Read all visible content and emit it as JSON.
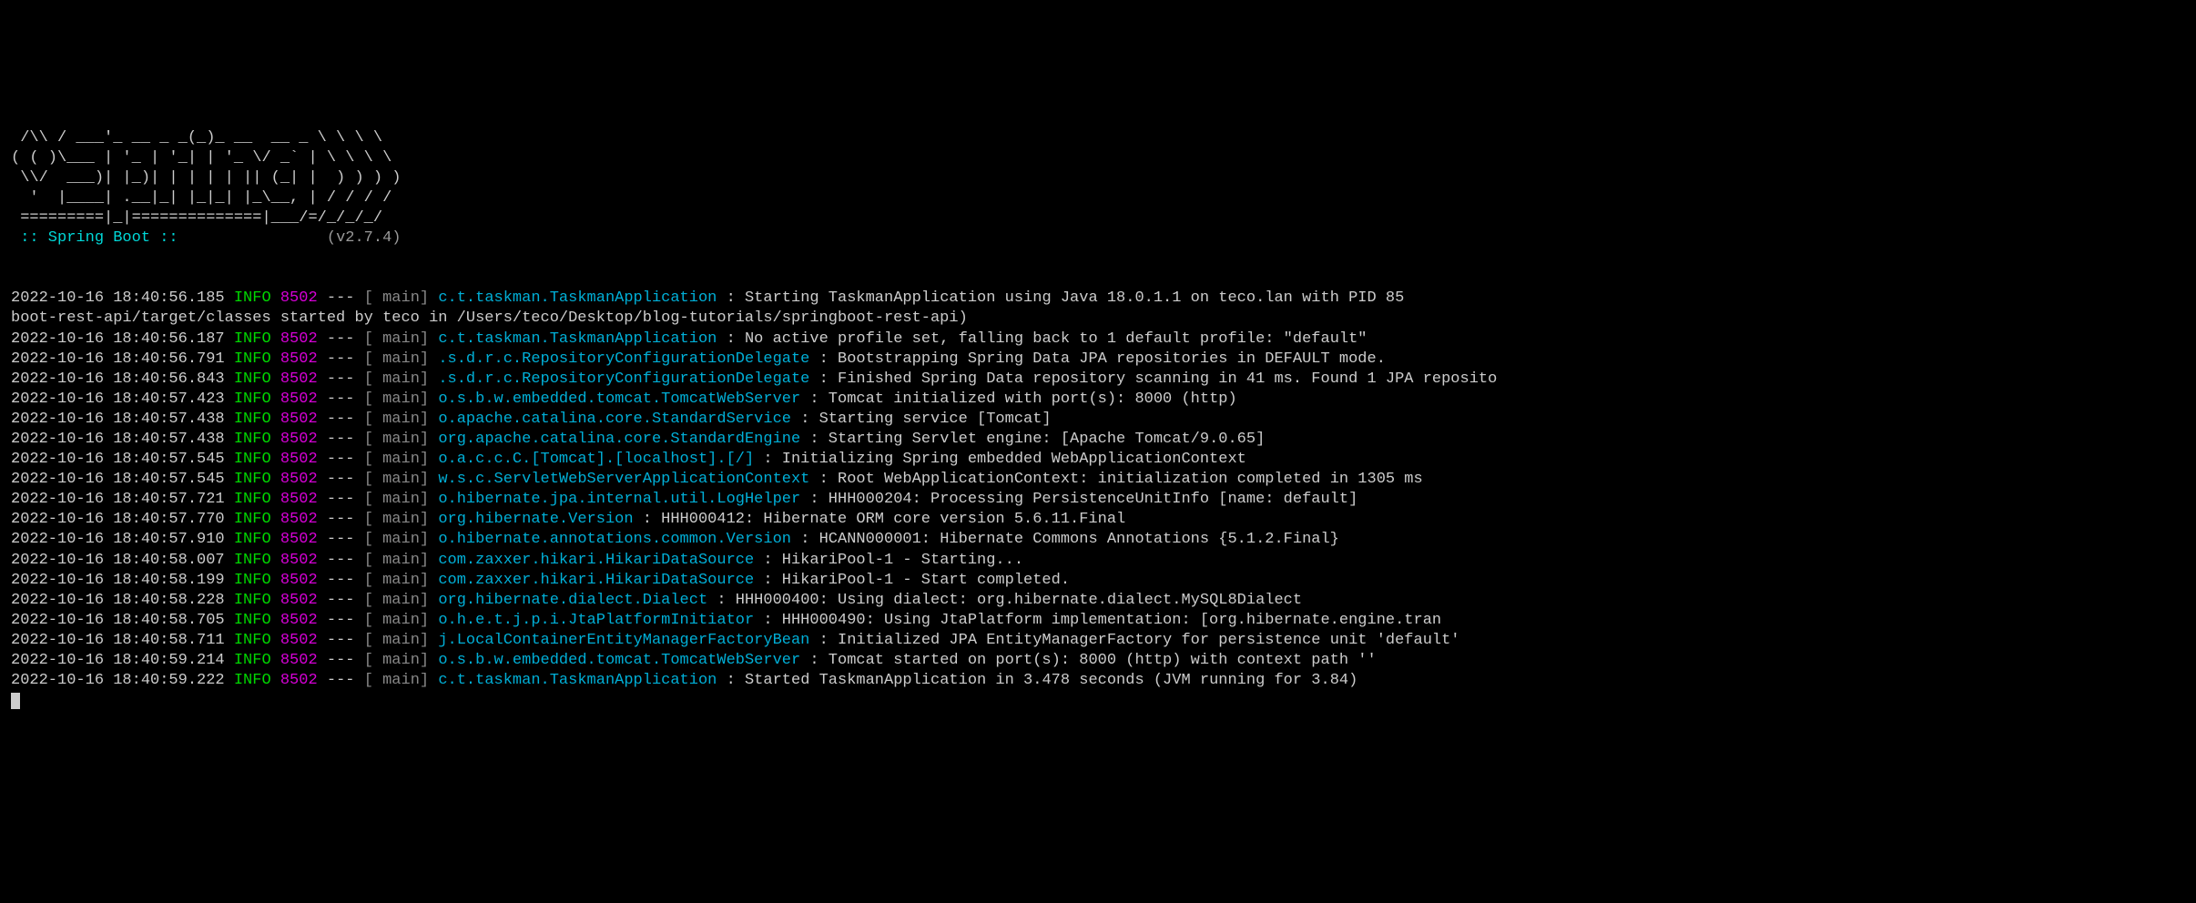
{
  "banner": {
    "lines": [
      " /\\\\ / ___'_ __ _ _(_)_ __  __ _ \\ \\ \\ \\",
      "( ( )\\___ | '_ | '_| | '_ \\/ _` | \\ \\ \\ \\",
      " \\\\/  ___)| |_)| | | | | || (_| |  ) ) ) )",
      "  '  |____| .__|_| |_|_| |_\\__, | / / / /",
      " =========|_|==============|___/=/_/_/_/"
    ],
    "springBootLabel": " :: Spring Boot ::",
    "version": "(v2.7.4)"
  },
  "logs": [
    {
      "timestamp": "2022-10-16 18:40:56.185",
      "level": "INFO",
      "pid": "8502",
      "thread": "main",
      "logger": "c.t.taskman.TaskmanApplication          ",
      "message": "Starting TaskmanApplication using Java 18.0.1.1 on teco.lan with PID 85",
      "wrap": "boot-rest-api/target/classes started by teco in /Users/teco/Desktop/blog-tutorials/springboot-rest-api)"
    },
    {
      "timestamp": "2022-10-16 18:40:56.187",
      "level": "INFO",
      "pid": "8502",
      "thread": "main",
      "logger": "c.t.taskman.TaskmanApplication          ",
      "message": "No active profile set, falling back to 1 default profile: \"default\""
    },
    {
      "timestamp": "2022-10-16 18:40:56.791",
      "level": "INFO",
      "pid": "8502",
      "thread": "main",
      "logger": ".s.d.r.c.RepositoryConfigurationDelegate",
      "message": "Bootstrapping Spring Data JPA repositories in DEFAULT mode."
    },
    {
      "timestamp": "2022-10-16 18:40:56.843",
      "level": "INFO",
      "pid": "8502",
      "thread": "main",
      "logger": ".s.d.r.c.RepositoryConfigurationDelegate",
      "message": "Finished Spring Data repository scanning in 41 ms. Found 1 JPA reposito"
    },
    {
      "timestamp": "2022-10-16 18:40:57.423",
      "level": "INFO",
      "pid": "8502",
      "thread": "main",
      "logger": "o.s.b.w.embedded.tomcat.TomcatWebServer ",
      "message": "Tomcat initialized with port(s): 8000 (http)"
    },
    {
      "timestamp": "2022-10-16 18:40:57.438",
      "level": "INFO",
      "pid": "8502",
      "thread": "main",
      "logger": "o.apache.catalina.core.StandardService  ",
      "message": "Starting service [Tomcat]"
    },
    {
      "timestamp": "2022-10-16 18:40:57.438",
      "level": "INFO",
      "pid": "8502",
      "thread": "main",
      "logger": "org.apache.catalina.core.StandardEngine ",
      "message": "Starting Servlet engine: [Apache Tomcat/9.0.65]"
    },
    {
      "timestamp": "2022-10-16 18:40:57.545",
      "level": "INFO",
      "pid": "8502",
      "thread": "main",
      "logger": "o.a.c.c.C.[Tomcat].[localhost].[/]      ",
      "message": "Initializing Spring embedded WebApplicationContext"
    },
    {
      "timestamp": "2022-10-16 18:40:57.545",
      "level": "INFO",
      "pid": "8502",
      "thread": "main",
      "logger": "w.s.c.ServletWebServerApplicationContext",
      "message": "Root WebApplicationContext: initialization completed in 1305 ms"
    },
    {
      "timestamp": "2022-10-16 18:40:57.721",
      "level": "INFO",
      "pid": "8502",
      "thread": "main",
      "logger": "o.hibernate.jpa.internal.util.LogHelper ",
      "message": "HHH000204: Processing PersistenceUnitInfo [name: default]"
    },
    {
      "timestamp": "2022-10-16 18:40:57.770",
      "level": "INFO",
      "pid": "8502",
      "thread": "main",
      "logger": "org.hibernate.Version                   ",
      "message": "HHH000412: Hibernate ORM core version 5.6.11.Final"
    },
    {
      "timestamp": "2022-10-16 18:40:57.910",
      "level": "INFO",
      "pid": "8502",
      "thread": "main",
      "logger": "o.hibernate.annotations.common.Version  ",
      "message": "HCANN000001: Hibernate Commons Annotations {5.1.2.Final}"
    },
    {
      "timestamp": "2022-10-16 18:40:58.007",
      "level": "INFO",
      "pid": "8502",
      "thread": "main",
      "logger": "com.zaxxer.hikari.HikariDataSource      ",
      "message": "HikariPool-1 - Starting..."
    },
    {
      "timestamp": "2022-10-16 18:40:58.199",
      "level": "INFO",
      "pid": "8502",
      "thread": "main",
      "logger": "com.zaxxer.hikari.HikariDataSource      ",
      "message": "HikariPool-1 - Start completed."
    },
    {
      "timestamp": "2022-10-16 18:40:58.228",
      "level": "INFO",
      "pid": "8502",
      "thread": "main",
      "logger": "org.hibernate.dialect.Dialect           ",
      "message": "HHH000400: Using dialect: org.hibernate.dialect.MySQL8Dialect"
    },
    {
      "timestamp": "2022-10-16 18:40:58.705",
      "level": "INFO",
      "pid": "8502",
      "thread": "main",
      "logger": "o.h.e.t.j.p.i.JtaPlatformInitiator      ",
      "message": "HHH000490: Using JtaPlatform implementation: [org.hibernate.engine.tran"
    },
    {
      "timestamp": "2022-10-16 18:40:58.711",
      "level": "INFO",
      "pid": "8502",
      "thread": "main",
      "logger": "j.LocalContainerEntityManagerFactoryBean",
      "message": "Initialized JPA EntityManagerFactory for persistence unit 'default'"
    },
    {
      "timestamp": "2022-10-16 18:40:59.214",
      "level": "INFO",
      "pid": "8502",
      "thread": "main",
      "logger": "o.s.b.w.embedded.tomcat.TomcatWebServer ",
      "message": "Tomcat started on port(s): 8000 (http) with context path ''"
    },
    {
      "timestamp": "2022-10-16 18:40:59.222",
      "level": "INFO",
      "pid": "8502",
      "thread": "main",
      "logger": "c.t.taskman.TaskmanApplication          ",
      "message": "Started TaskmanApplication in 3.478 seconds (JVM running for 3.84)"
    }
  ]
}
